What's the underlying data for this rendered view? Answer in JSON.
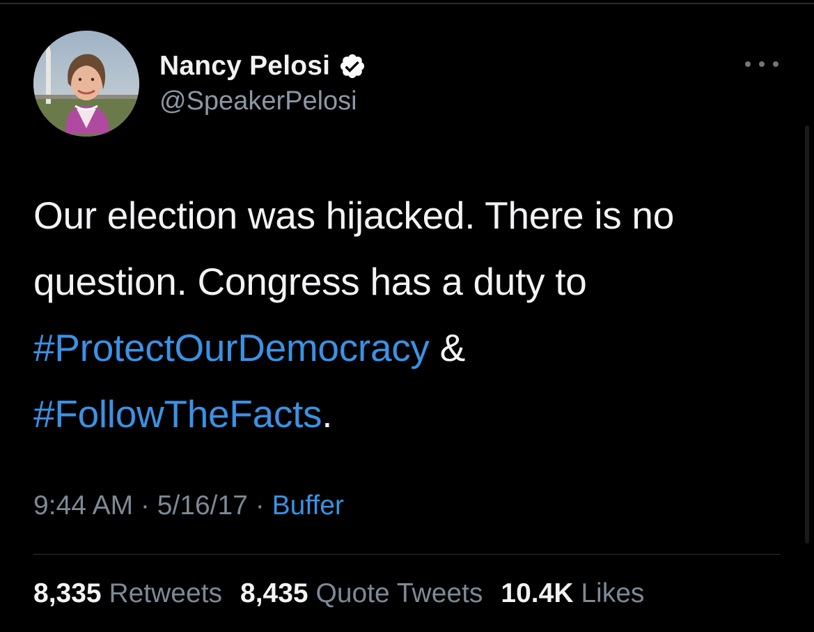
{
  "author": {
    "name": "Nancy Pelosi",
    "handle": "@SpeakerPelosi",
    "verified": true
  },
  "tweet": {
    "line1": "Our election was hijacked. There is no",
    "line2": "question. Congress has a duty to",
    "hashtag1": "#ProtectOurDemocracy",
    "connector": " &",
    "hashtag2": "#FollowTheFacts",
    "end": "."
  },
  "meta": {
    "time": "9:44 AM",
    "sep1": " · ",
    "date": "5/16/17",
    "sep2": " · ",
    "source": "Buffer"
  },
  "stats": {
    "retweets_count": "8,335",
    "retweets_label": "Retweets",
    "quotes_count": "8,435",
    "quotes_label": "Quote Tweets",
    "likes_count": "10.4K",
    "likes_label": "Likes"
  },
  "colors": {
    "background": "#000000",
    "link": "#3a92e4",
    "secondary_text": "#7d8a96",
    "primary_text": "#f2f3f4",
    "verified_badge": "#ffffff"
  },
  "icons": {
    "verified": "verified-badge-icon",
    "more": "more-dots-icon"
  }
}
